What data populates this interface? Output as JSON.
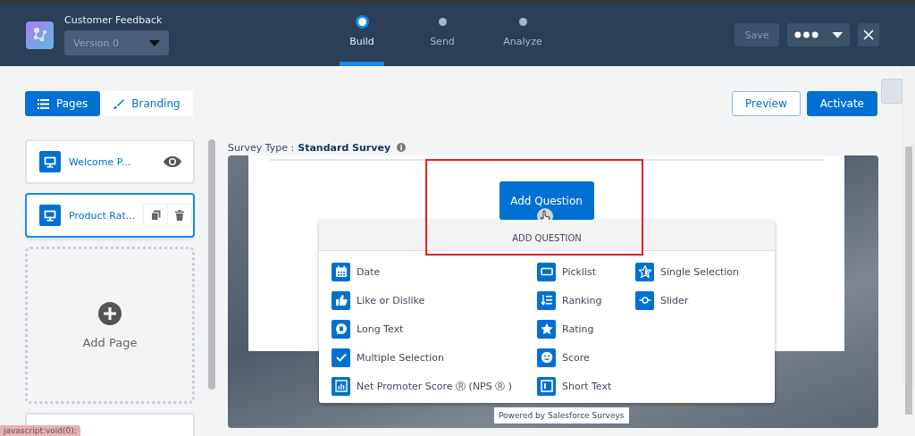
{
  "header": {
    "title": "Customer Feedback",
    "version": "Version 0",
    "steps": [
      {
        "label": "Build",
        "selected": true
      },
      {
        "label": "Send",
        "selected": false
      },
      {
        "label": "Analyze",
        "selected": false
      }
    ],
    "save": "Save",
    "save_disabled": true
  },
  "view_tabs": [
    {
      "label": "Pages",
      "kind": "list",
      "selected": true
    },
    {
      "label": "Branding",
      "kind": "brush",
      "selected": false
    }
  ],
  "actions": {
    "preview": "Preview",
    "activate": "Activate"
  },
  "pages": [
    {
      "title": "Welcome P...",
      "selected": false
    },
    {
      "title": "Product Rat...",
      "selected": true
    }
  ],
  "add_page": "Add Page",
  "survey_type": {
    "label": "Survey Type :",
    "value": "Standard Survey"
  },
  "add_question_button": "Add Question",
  "menu": {
    "title": "ADD QUESTION",
    "columns": [
      [
        {
          "label": "Date",
          "kind": "date"
        },
        {
          "label": "Like or Dislike",
          "kind": "like"
        },
        {
          "label": "Long Text",
          "kind": "longtext"
        },
        {
          "label": "Multiple Selection",
          "kind": "check"
        },
        {
          "label": "Net Promoter Score Ⓡ  (NPS Ⓡ )",
          "kind": "nps"
        }
      ],
      [
        {
          "label": "Picklist",
          "kind": "picklist"
        },
        {
          "label": "Ranking",
          "kind": "ranking"
        },
        {
          "label": "Rating",
          "kind": "star"
        },
        {
          "label": "Score",
          "kind": "smile"
        },
        {
          "label": "Short Text",
          "kind": "shorttext"
        }
      ],
      [
        {
          "label": "Single Selection",
          "kind": "singlestar"
        },
        {
          "label": "Slider",
          "kind": "slider"
        }
      ]
    ]
  },
  "powered_by": "Powered by Salesforce Surveys",
  "status_url": "javascript:void(0);"
}
